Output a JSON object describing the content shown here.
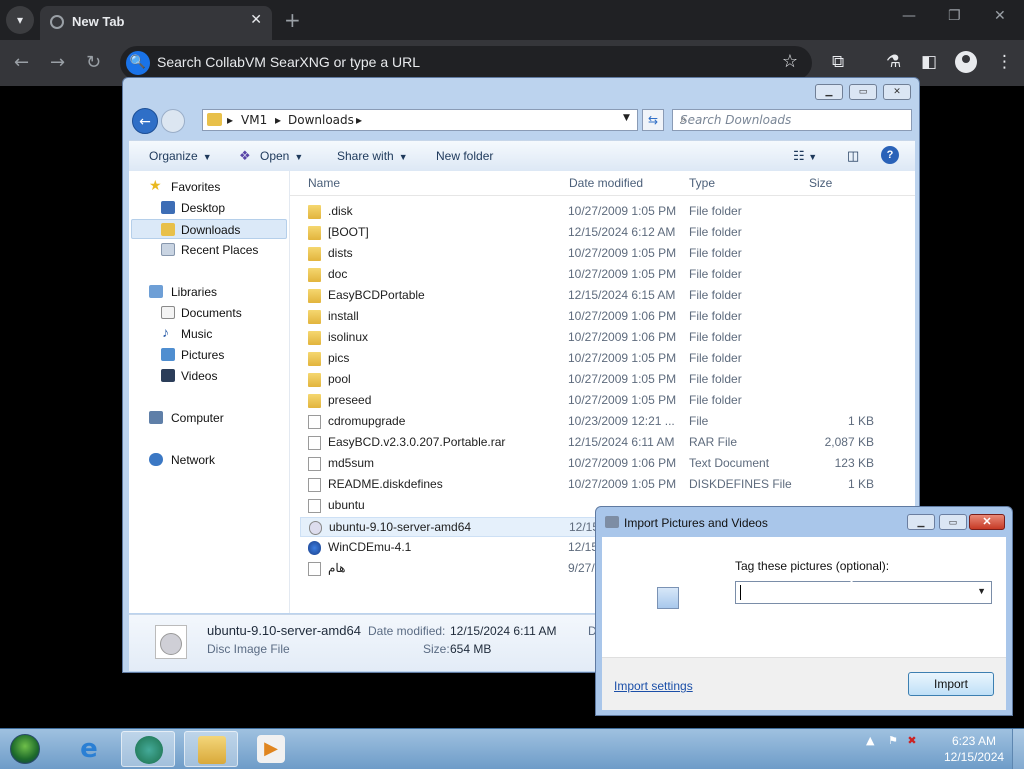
{
  "browser": {
    "tab_title": "New Tab",
    "omnibox_text": "Search CollabVM SearXNG or type a URL",
    "tab_close": "✕",
    "new_tab": "+",
    "minimize": "—",
    "restore": "❐",
    "close": "✕"
  },
  "explorer": {
    "breadcrumb": [
      "VM1",
      "Downloads"
    ],
    "search_placeholder": "Search Downloads",
    "toolbar": {
      "organize": "Organize",
      "open": "Open",
      "share_with": "Share with",
      "new_folder": "New folder"
    },
    "nav": {
      "favorites": "Favorites",
      "desktop": "Desktop",
      "downloads": "Downloads",
      "recent_places": "Recent Places",
      "libraries": "Libraries",
      "documents": "Documents",
      "music": "Music",
      "pictures": "Pictures",
      "videos": "Videos",
      "computer": "Computer",
      "network": "Network"
    },
    "columns": {
      "name": "Name",
      "date": "Date modified",
      "type": "Type",
      "size": "Size"
    },
    "files": [
      {
        "name": ".disk",
        "date": "10/27/2009 1:05 PM",
        "type": "File folder",
        "size": ""
      },
      {
        "name": "[BOOT]",
        "date": "12/15/2024 6:12 AM",
        "type": "File folder",
        "size": ""
      },
      {
        "name": "dists",
        "date": "10/27/2009 1:05 PM",
        "type": "File folder",
        "size": ""
      },
      {
        "name": "doc",
        "date": "10/27/2009 1:05 PM",
        "type": "File folder",
        "size": ""
      },
      {
        "name": "EasyBCDPortable",
        "date": "12/15/2024 6:15 AM",
        "type": "File folder",
        "size": ""
      },
      {
        "name": "install",
        "date": "10/27/2009 1:06 PM",
        "type": "File folder",
        "size": ""
      },
      {
        "name": "isolinux",
        "date": "10/27/2009 1:06 PM",
        "type": "File folder",
        "size": ""
      },
      {
        "name": "pics",
        "date": "10/27/2009 1:05 PM",
        "type": "File folder",
        "size": ""
      },
      {
        "name": "pool",
        "date": "10/27/2009 1:05 PM",
        "type": "File folder",
        "size": ""
      },
      {
        "name": "preseed",
        "date": "10/27/2009 1:05 PM",
        "type": "File folder",
        "size": ""
      },
      {
        "name": "cdromupgrade",
        "date": "10/23/2009 12:21 ...",
        "type": "File",
        "size": "1 KB"
      },
      {
        "name": "EasyBCD.v2.3.0.207.Portable.rar",
        "date": "12/15/2024 6:11 AM",
        "type": "RAR File",
        "size": "2,087 KB"
      },
      {
        "name": "md5sum",
        "date": "10/27/2009 1:06 PM",
        "type": "Text Document",
        "size": "123 KB"
      },
      {
        "name": "README.diskdefines",
        "date": "10/27/2009 1:05 PM",
        "type": "DISKDEFINES File",
        "size": "1 KB"
      },
      {
        "name": "ubuntu",
        "date": "",
        "type": "",
        "size": ""
      },
      {
        "name": "ubuntu-9.10-server-amd64",
        "date": "12/15",
        "type": "",
        "size": ""
      },
      {
        "name": "WinCDEmu-4.1",
        "date": "12/15",
        "type": "",
        "size": ""
      },
      {
        "name": "هام",
        "date": "9/27/",
        "type": "",
        "size": ""
      }
    ],
    "details": {
      "name": "ubuntu-9.10-server-amd64",
      "type": "Disc Image File",
      "date_label": "Date modified:",
      "date_value": "12/15/2024 6:11 AM",
      "size_label": "Size:",
      "size_value": "654 MB",
      "extra": "D"
    }
  },
  "import_dialog": {
    "title": "Import Pictures and Videos",
    "tag_label": "Tag these pictures (optional):",
    "tag_value": "",
    "settings_link": "Import settings",
    "import_button": "Import"
  },
  "taskbar": {
    "time": "6:23 AM",
    "date": "12/15/2024"
  }
}
